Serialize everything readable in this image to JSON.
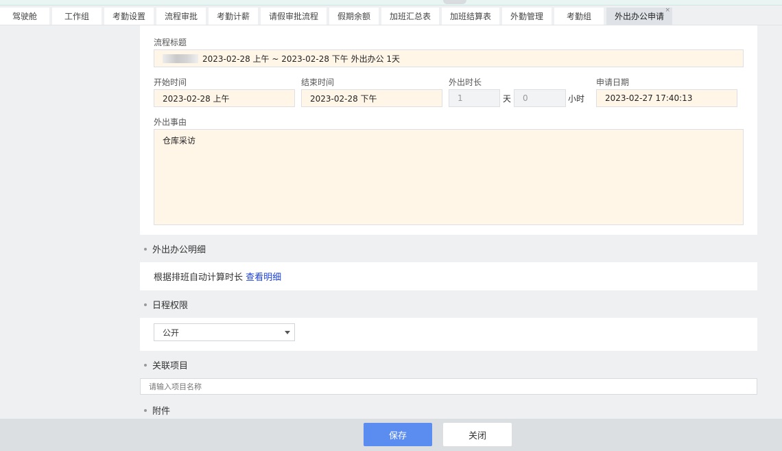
{
  "tabs": [
    {
      "label": "驾驶舱"
    },
    {
      "label": "工作组"
    },
    {
      "label": "考勤设置"
    },
    {
      "label": "流程审批"
    },
    {
      "label": "考勤计薪"
    },
    {
      "label": "请假审批流程"
    },
    {
      "label": "假期余额"
    },
    {
      "label": "加班汇总表"
    },
    {
      "label": "加班结算表"
    },
    {
      "label": "外勤管理"
    },
    {
      "label": "考勤组"
    },
    {
      "label": "外出办公申请",
      "active": true,
      "close_glyph": "×"
    }
  ],
  "form": {
    "title_label": "流程标题",
    "title_value": "2023-02-28 上午 ~ 2023-02-28 下午 外出办公 1天",
    "start_label": "开始时间",
    "start_value": "2023-02-28 上午",
    "end_label": "结束时间",
    "end_value": "2023-02-28 下午",
    "duration_label": "外出时长",
    "duration_days": "1",
    "days_unit": "天",
    "duration_hours": "0",
    "hours_unit": "小时",
    "apply_date_label": "申请日期",
    "apply_date_value": "2023-02-27 17:40:13",
    "reason_label": "外出事由",
    "reason_value": "仓库采访"
  },
  "sections": {
    "detail_title": "外出办公明细",
    "detail_text": "根据排班自动计算时长",
    "detail_link": "查看明细",
    "schedule_title": "日程权限",
    "schedule_value": "公开",
    "project_title": "关联项目",
    "project_placeholder": "请输入项目名称",
    "attachment_title": "附件"
  },
  "footer": {
    "save_label": "保存",
    "close_label": "关闭"
  },
  "colors": {
    "primary": "#5b8cf0",
    "link": "#1a3fd6",
    "field_bg": "#fff6e8"
  }
}
